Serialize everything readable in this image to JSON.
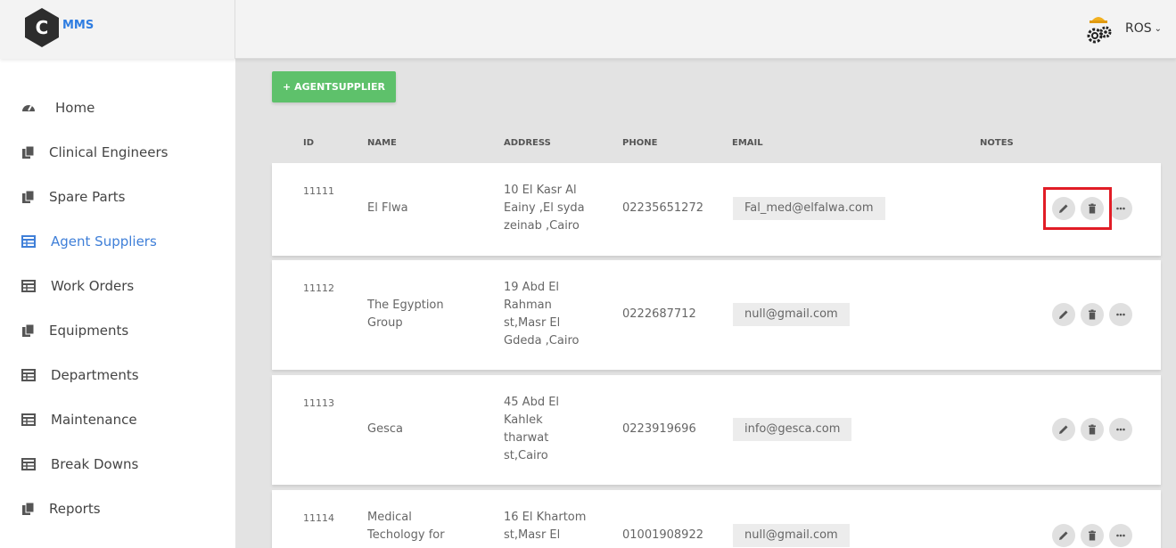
{
  "brand": {
    "logo_letter": "C",
    "name": "MMS",
    "accent": "#2f7de1"
  },
  "user": {
    "name": "ROS",
    "avatar_icon": "worker-gears-icon"
  },
  "sidebar": {
    "items": [
      {
        "label": "Home",
        "icon": "dashboard-icon",
        "active": false
      },
      {
        "label": "Clinical Engineers",
        "icon": "document-icon",
        "active": false
      },
      {
        "label": "Spare Parts",
        "icon": "document-icon",
        "active": false
      },
      {
        "label": "Agent Suppliers",
        "icon": "table-icon",
        "active": true
      },
      {
        "label": "Work Orders",
        "icon": "table-icon",
        "active": false
      },
      {
        "label": "Equipments",
        "icon": "document-icon",
        "active": false
      },
      {
        "label": "Departments",
        "icon": "table-icon",
        "active": false
      },
      {
        "label": "Maintenance",
        "icon": "table-icon",
        "active": false
      },
      {
        "label": "Break Downs",
        "icon": "table-icon",
        "active": false
      },
      {
        "label": "Reports",
        "icon": "document-icon",
        "active": false
      }
    ]
  },
  "toolbar": {
    "add_label": "+ AGENTSUPPLIER",
    "add_color": "#5ec16b"
  },
  "table": {
    "headers": {
      "id": "ID",
      "name": "NAME",
      "address": "ADDRESS",
      "phone": "PHONE",
      "email": "EMAIL",
      "notes": "NOTES"
    },
    "rows": [
      {
        "id": "11111",
        "name": "El Flwa",
        "address": "10 El Kasr Al Eainy ,El syda zeinab ,Cairo",
        "phone": "02235651272",
        "email": "Fal_med@elfalwa.com",
        "notes": ""
      },
      {
        "id": "11112",
        "name": "The Egyption Group",
        "address": "19 Abd El Rahman st,Masr El Gdeda ,Cairo",
        "phone": "0222687712",
        "email": "null@gmail.com",
        "notes": ""
      },
      {
        "id": "11113",
        "name": "Gesca",
        "address": "45 Abd El Kahlek tharwat st,Cairo",
        "phone": "0223919696",
        "email": "info@gesca.com",
        "notes": ""
      },
      {
        "id": "11114",
        "name": "Medical Techology for",
        "address": "16 El Khartom st,Masr El",
        "phone": "01001908922",
        "email": "null@gmail.com",
        "notes": ""
      }
    ],
    "actions": [
      "edit-icon",
      "delete-icon",
      "more-icon"
    ]
  },
  "highlight_color": "#e11d26"
}
